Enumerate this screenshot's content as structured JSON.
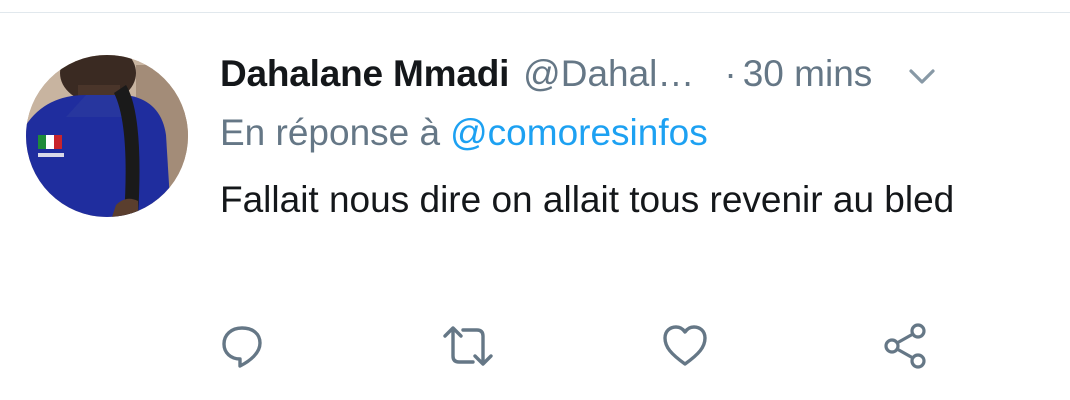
{
  "tweet": {
    "display_name": "Dahalane Mmadi",
    "handle": "@Dahal…",
    "separator": "·",
    "time": "30 mins",
    "reply_prefix": "En réponse à",
    "reply_mention": "@comoresinfos",
    "text": "Fallait nous dire on allait tous revenir au bled"
  },
  "icons": {
    "menu": "chevron-down-icon",
    "reply": "reply-icon",
    "retweet": "retweet-icon",
    "like": "heart-icon",
    "share": "share-icon"
  },
  "colors": {
    "name": "#14171a",
    "secondary": "#657786",
    "link": "#1da1f2",
    "icon": "#657786",
    "divider": "#e1e8ed"
  }
}
